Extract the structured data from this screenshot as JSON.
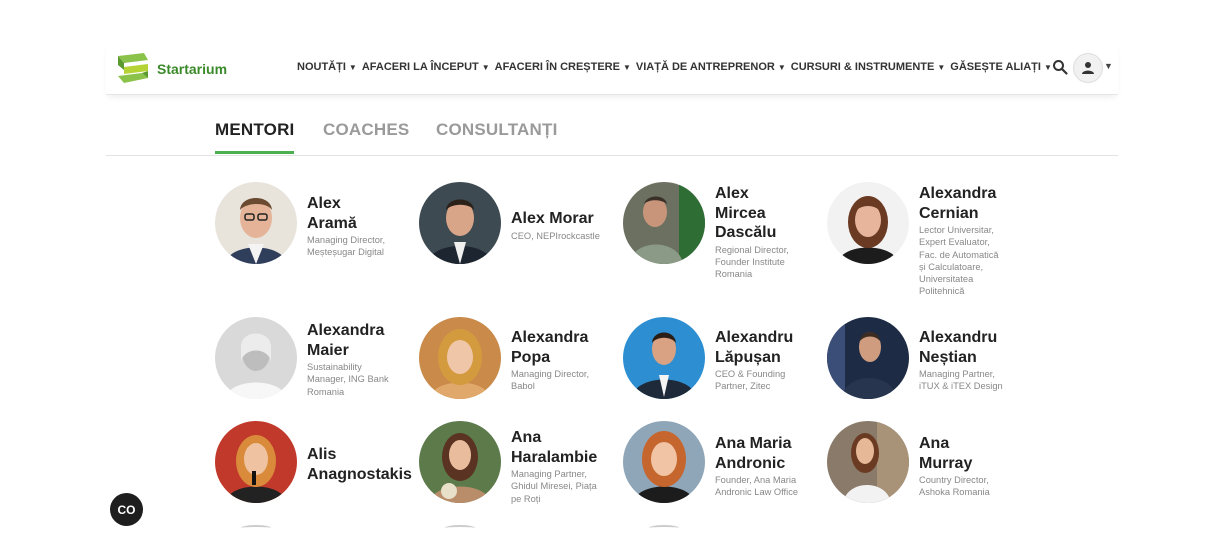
{
  "brand": {
    "name": "Startarium",
    "color": "#3b8a2a"
  },
  "nav": [
    {
      "label": "NOUTĂȚI"
    },
    {
      "label": "AFACERI LA ÎNCEPUT"
    },
    {
      "label": "AFACERI ÎN CREȘTERE"
    },
    {
      "label": "VIAȚĂ DE ANTREPRENOR"
    },
    {
      "label": "CURSURI & INSTRUMENTE"
    },
    {
      "label": "GĂSEȘTE ALIAȚI"
    }
  ],
  "tabs": [
    {
      "label": "MENTORI",
      "active": true
    },
    {
      "label": "COACHES",
      "active": false
    },
    {
      "label": "CONSULTANȚI",
      "active": false
    }
  ],
  "accent": "#4caf50",
  "people": [
    {
      "name": "Alex Aramă",
      "title": "Managing Director, Meșteșugar Digital"
    },
    {
      "name": "Alex Morar",
      "title": "CEO, NEPIrockcastle"
    },
    {
      "name": "Alex Mircea Dascălu",
      "title": "Regional Director, Founder Institute Romania"
    },
    {
      "name": "Alexandra Cernian",
      "title": "Lector Universitar, Expert Evaluator, Fac. de Automatică și Calculatoare, Universitatea Politehnică"
    },
    {
      "name": "Alexandra Maier",
      "title": "Sustainability Manager, ING Bank Romania"
    },
    {
      "name": "Alexandra Popa",
      "title": "Managing Director, Babol"
    },
    {
      "name": "Alexandru Lăpușan",
      "title": "CEO & Founding Partner, Zitec"
    },
    {
      "name": "Alexandru Neștian",
      "title": "Managing Partner, iTUX & iTEX Design"
    },
    {
      "name": "Alis Anagnostakis",
      "title": ""
    },
    {
      "name": "Ana Haralambie",
      "title": "Managing Partner, Ghidul Miresei, Piața pe Roți"
    },
    {
      "name": "Ana Maria Andronic",
      "title": "Founder, Ana Maria Andronic Law Office"
    },
    {
      "name": "Ana Murray",
      "title": "Country Director, Ashoka Romania"
    }
  ],
  "cc_button": {
    "label": "CO"
  }
}
